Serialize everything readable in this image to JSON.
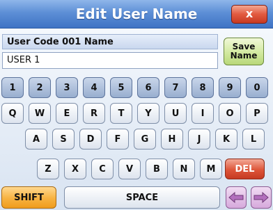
{
  "window": {
    "title": "Edit User Name",
    "close_label": "x"
  },
  "name_field": {
    "label": "User Code 001 Name",
    "value": "USER 1"
  },
  "save_button": {
    "line1": "Save",
    "line2": "Name"
  },
  "keyboard": {
    "number_row": [
      "1",
      "2",
      "3",
      "4",
      "5",
      "6",
      "7",
      "8",
      "9",
      "0"
    ],
    "row_q": [
      "Q",
      "W",
      "E",
      "R",
      "T",
      "Y",
      "U",
      "I",
      "O",
      "P"
    ],
    "row_a": [
      "A",
      "S",
      "D",
      "F",
      "G",
      "H",
      "J",
      "K",
      "L"
    ],
    "row_z": [
      "Z",
      "X",
      "C",
      "V",
      "B",
      "N",
      "M"
    ],
    "del_label": "DEL",
    "shift_label": "SHIFT",
    "space_label": "SPACE",
    "left_arrow_icon": "arrow-left-icon",
    "right_arrow_icon": "arrow-right-icon"
  },
  "colors": {
    "title_bar": "#5d8fd6",
    "close_button": "#e25a3f",
    "save_button": "#d2e9a0",
    "number_keys": "#98aecf",
    "delete_key": "#dd5539",
    "shift_key": "#f7b240",
    "arrow_keys": "#d6a9dc"
  }
}
